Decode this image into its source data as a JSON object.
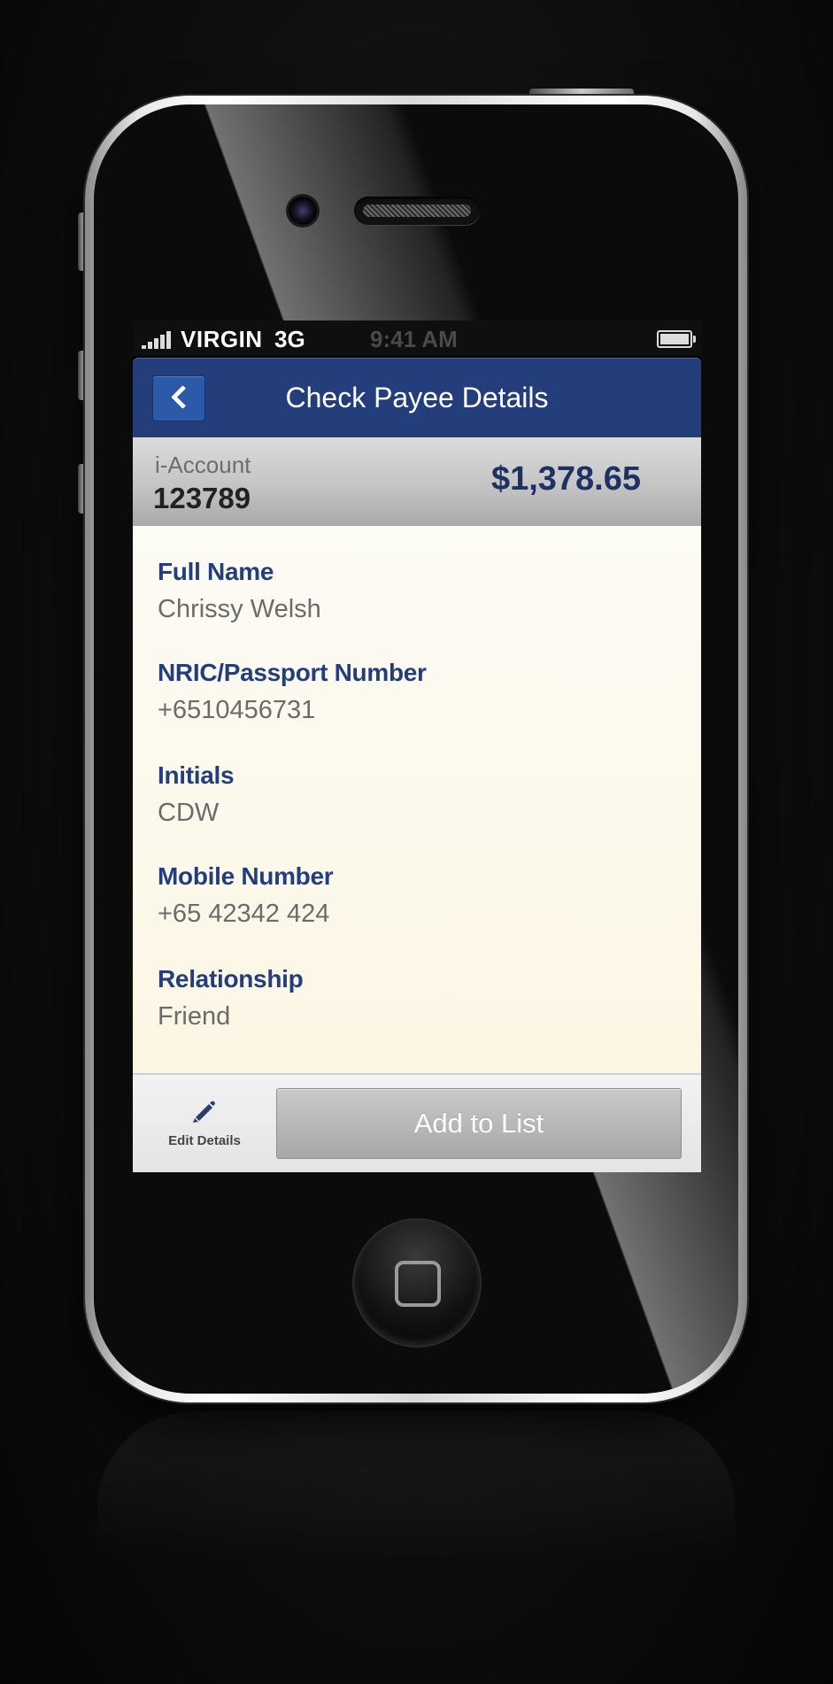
{
  "status_bar": {
    "carrier": "VIRGIN",
    "network": "3G",
    "time": "9:41 AM"
  },
  "nav": {
    "title": "Check Payee Details",
    "back_icon": "chevron-left-icon"
  },
  "account": {
    "label": "i-Account",
    "number": "123789",
    "balance": "$1,378.65"
  },
  "details": [
    {
      "label": "Full Name",
      "value": "Chrissy Welsh"
    },
    {
      "label": "NRIC/Passport Number",
      "value": "+6510456731"
    },
    {
      "label": "Initials",
      "value": "CDW"
    },
    {
      "label": "Mobile Number",
      "value": "+65 42342 424"
    },
    {
      "label": "Relationship",
      "value": "Friend"
    }
  ],
  "toolbar": {
    "edit_label": "Edit Details",
    "edit_icon": "pencil-icon",
    "add_label": "Add to List"
  },
  "colors": {
    "nav_blue": "#233e7b",
    "label_blue": "#233e7b",
    "balance_navy": "#1e3163",
    "detail_background": "#fcf6e4"
  }
}
